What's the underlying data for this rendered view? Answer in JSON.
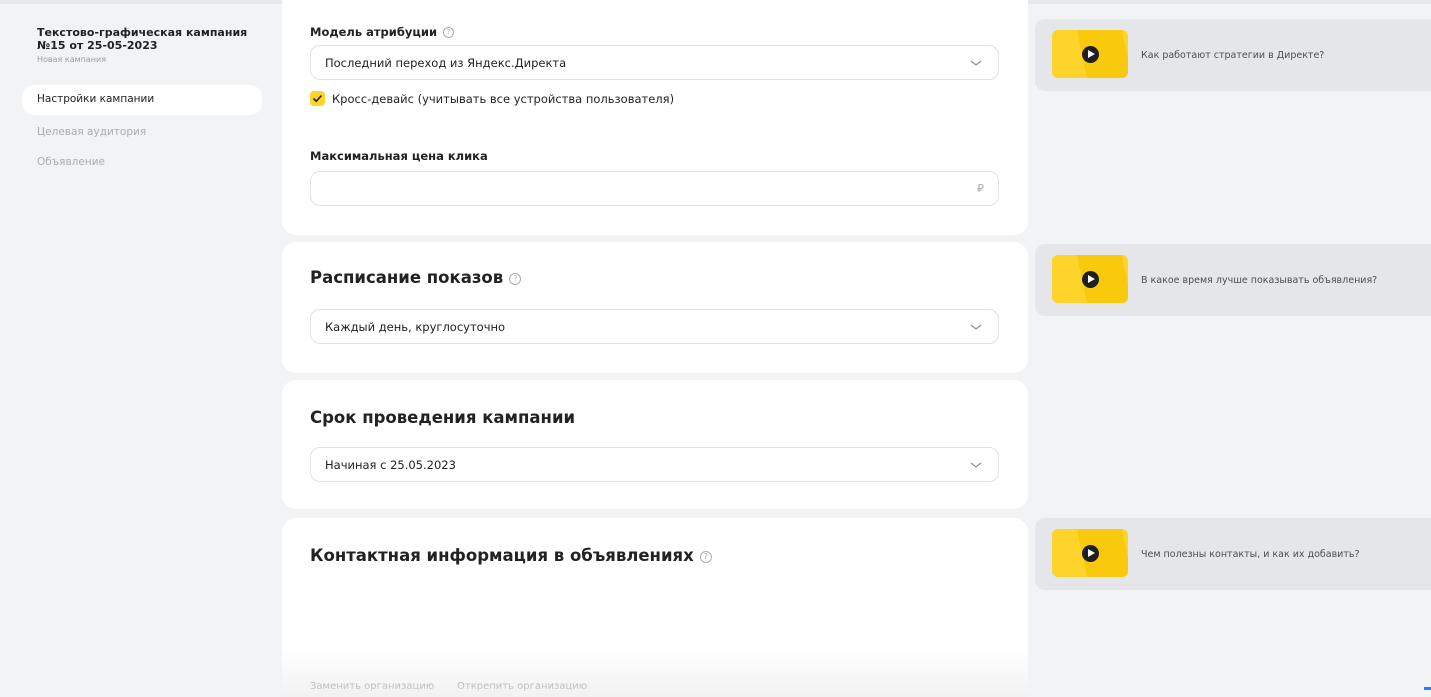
{
  "sidebar": {
    "campaign_title": "Текстово-графическая кампания №15 от 25-05-2023",
    "campaign_status": "Новая кампания",
    "nav": {
      "settings": "Настройки кампании",
      "audience": "Целевая аудитория",
      "ad": "Объявление"
    }
  },
  "attribution": {
    "label": "Модель атрибуции",
    "value": "Последний переход из Яндекс.Директа",
    "crossdevice_label": "Кросс-девайс (учитывать все устройства пользователя)",
    "crossdevice_checked": true
  },
  "max_click": {
    "label": "Максимальная цена клика",
    "value": "",
    "currency": "₽"
  },
  "schedule": {
    "title": "Расписание показов",
    "value": "Каждый день, круглосуточно"
  },
  "period": {
    "title": "Срок проведения кампании",
    "value": "Начиная с 25.05.2023"
  },
  "contacts": {
    "title": "Контактная информация в объявлениях",
    "replace_org": "Заменить организацию",
    "detach_org": "Открепить организацию"
  },
  "hints": [
    {
      "text": "Как работают стратегии в Директе?"
    },
    {
      "text": "В какое время лучше показывать объявления?"
    },
    {
      "text": "Чем полезны контакты, и как их добавить?"
    }
  ],
  "icons": {
    "help": "question-circle-icon",
    "chevron": "chevron-down-icon",
    "play": "play-icon",
    "check": "check-icon"
  },
  "colors": {
    "accent": "#fed42b",
    "background": "#f2f3f5",
    "card": "#ffffff",
    "hint_bg": "#e4e6ea"
  }
}
